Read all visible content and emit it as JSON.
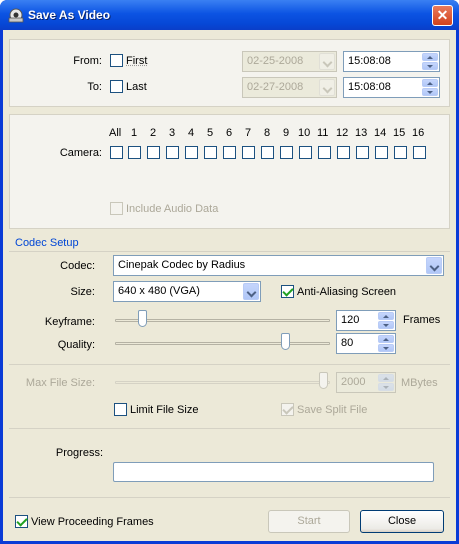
{
  "window": {
    "title": "Save As Video"
  },
  "time_range": {
    "from_label": "From:",
    "to_label": "To:",
    "first_label": "First",
    "last_label": "Last",
    "first_checked": false,
    "last_checked": false,
    "from_date": "02-25-2008",
    "to_date": "02-27-2008",
    "from_time": "15:08:08",
    "to_time": "15:08:08"
  },
  "camera": {
    "label": "Camera:",
    "all_label": "All",
    "numbers": [
      "1",
      "2",
      "3",
      "4",
      "5",
      "6",
      "7",
      "8",
      "9",
      "10",
      "11",
      "12",
      "13",
      "14",
      "15",
      "16"
    ],
    "include_audio_label": "Include Audio Data"
  },
  "codec_setup": {
    "section_title": "Codec Setup",
    "codec_label": "Codec:",
    "codec_value": "Cinepak Codec by Radius",
    "size_label": "Size:",
    "size_value": "640 x 480 (VGA)",
    "anti_aliasing_label": "Anti-Aliasing Screen",
    "anti_aliasing_checked": true,
    "keyframe_label": "Keyframe:",
    "keyframe_value": "120",
    "frames_label": "Frames",
    "quality_label": "Quality:",
    "quality_value": "80"
  },
  "file_size": {
    "max_label": "Max File Size:",
    "max_value": "2000",
    "unit_label": "MBytes",
    "limit_label": "Limit File Size",
    "limit_checked": false,
    "save_split_label": "Save Split File",
    "save_split_checked": true
  },
  "progress": {
    "label": "Progress:",
    "value": 0
  },
  "footer": {
    "view_frames_label": "View Proceeding Frames",
    "view_frames_checked": true,
    "start_label": "Start",
    "close_label": "Close"
  },
  "colors": {
    "titlebar": "#0c54e3",
    "section_title": "#0046d5",
    "close_button": "#d2421c",
    "check": "#21a121"
  }
}
